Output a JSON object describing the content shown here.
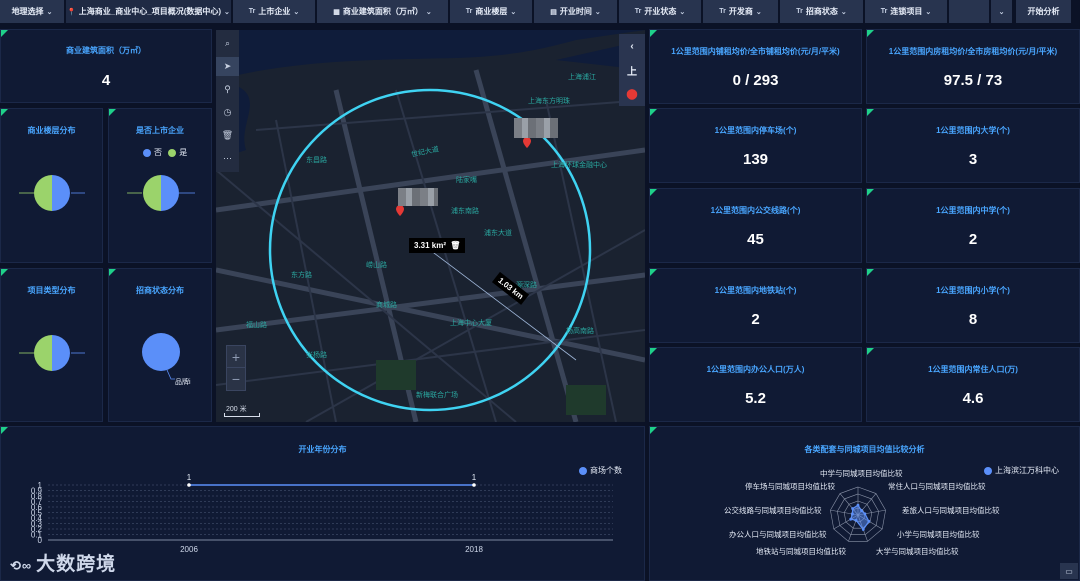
{
  "topbar": {
    "region": "地理选择",
    "project": "上海商业_商业中心_项目概况(数据中心)",
    "listed": "上市企业",
    "area": "商业建筑面积（万㎡）",
    "floors": "商业楼层",
    "open_time": "开业时间",
    "open_status": "开业状态",
    "developer": "开发商",
    "invest_status": "招商状态",
    "chain": "连锁项目",
    "start": "开始分析",
    "type_icon": "Tr"
  },
  "left": {
    "area_title": "商业建筑面积（万㎡）",
    "area_value": "4",
    "floor_title": "商业楼层分布",
    "listed_title": "是否上市企业",
    "listed_legend": [
      "否",
      "是"
    ],
    "type_title": "项目类型分布",
    "invest_title": "招商状态分布",
    "invest_label": "品牌i"
  },
  "map": {
    "area_label": "3.31 km²",
    "area_icon": "🗑",
    "radius_label": "1.03 km",
    "scale_label": "200 米",
    "right_top": "上",
    "pois": [
      "上海浦江",
      "上海东方明珠",
      "世纪大道",
      "上海环球金融中心",
      "东昌路",
      "陆家嘴",
      "浦东南路",
      "浦东大道",
      "东方路",
      "商城路",
      "上海中心大厦",
      "杨高南路",
      "张杨路",
      "新梅联合广场",
      "福山路",
      "崂山路",
      "源深路"
    ]
  },
  "stats": [
    {
      "title": "1公里范围内铺租均价/全市铺租均价(元/月/平米)",
      "value": "0 / 293"
    },
    {
      "title": "1公里范围内房租均价/全市房租均价(元/月/平米)",
      "value": "97.5 / 73"
    },
    {
      "title": "1公里范围内停车场(个)",
      "value": "139"
    },
    {
      "title": "1公里范围内大学(个)",
      "value": "3"
    },
    {
      "title": "1公里范围内公交线路(个)",
      "value": "45"
    },
    {
      "title": "1公里范围内中学(个)",
      "value": "2"
    },
    {
      "title": "1公里范围内地铁站(个)",
      "value": "2"
    },
    {
      "title": "1公里范围内小学(个)",
      "value": "8"
    },
    {
      "title": "1公里范围内办公人口(万人)",
      "value": "5.2"
    },
    {
      "title": "1公里范围内常住人口(万)",
      "value": "4.6"
    }
  ],
  "open_year": {
    "title": "开业年份分布",
    "legend": "商场个数"
  },
  "radar": {
    "title": "各类配套与同城项目均值比较分析",
    "legend": "上海滨江万科中心",
    "labels": [
      "中学与同城项目均值比较",
      "常住人口与同城项目均值比较",
      "差旅人口与同城项目均值比较",
      "小学与同城项目均值比较",
      "大学与同城项目均值比较",
      "地铁站与同城项目均值比较",
      "办公人口与同城项目均值比较",
      "公交线路与同城项目均值比较",
      "停车场与同城项目均值比较"
    ]
  },
  "chart_data": [
    {
      "type": "pie",
      "title": "商业楼层分布",
      "values": [
        1,
        1
      ],
      "colors": [
        "#5b8ff9",
        "#9bd36b"
      ]
    },
    {
      "type": "pie",
      "title": "是否上市企业",
      "labels": [
        "否",
        "是"
      ],
      "values": [
        1,
        1
      ],
      "colors": [
        "#5b8ff9",
        "#9bd36b"
      ]
    },
    {
      "type": "pie",
      "title": "项目类型分布",
      "values": [
        1,
        1
      ],
      "colors": [
        "#5b8ff9",
        "#9bd36b"
      ]
    },
    {
      "type": "pie",
      "title": "招商状态分布",
      "labels": [
        "品牌i"
      ],
      "values": [
        1
      ],
      "colors": [
        "#5b8ff9"
      ]
    },
    {
      "type": "line",
      "title": "开业年份分布",
      "x": [
        "2006",
        "2018"
      ],
      "series": [
        {
          "name": "商场个数",
          "values": [
            1,
            1
          ]
        }
      ],
      "yticks": [
        "0",
        "0.1",
        "0.2",
        "0.3",
        "0.4",
        "0.5",
        "0.6",
        "0.7",
        "0.8",
        "0.9",
        "1"
      ],
      "ylim": [
        0,
        1
      ]
    },
    {
      "type": "radar",
      "title": "各类配套与同城项目均值比较分析",
      "series": [
        {
          "name": "上海滨江万科中心",
          "values": [
            0.35,
            0.2,
            0.25,
            0.45,
            0.55,
            0.2,
            0.3,
            0.2,
            0.3
          ]
        }
      ]
    }
  ],
  "logo": "大数跨境",
  "chat_icon": "chat-icon"
}
